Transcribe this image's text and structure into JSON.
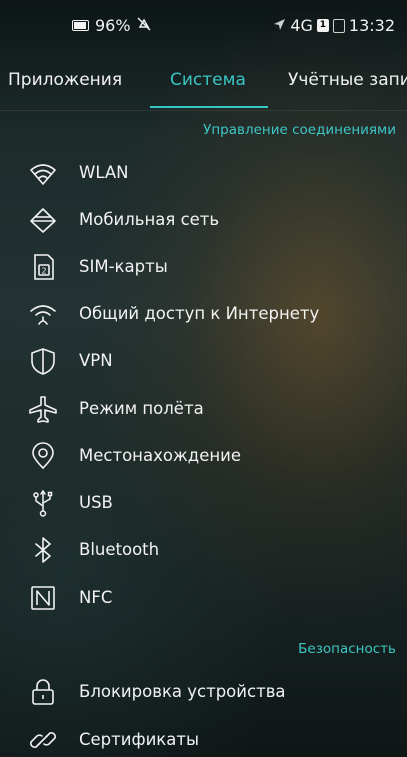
{
  "status_bar": {
    "battery": "96%",
    "network": "4G",
    "sim_badge": "1",
    "time": "13:32"
  },
  "tabs": [
    {
      "label": "Приложения",
      "active": false
    },
    {
      "label": "Система",
      "active": true
    },
    {
      "label": "Учётные запи",
      "active": false
    }
  ],
  "sections": {
    "connections": {
      "title": "Управление соединениями",
      "items": [
        {
          "label": "WLAN",
          "icon": "wifi-icon"
        },
        {
          "label": "Мобильная сеть",
          "icon": "mobile-network-icon"
        },
        {
          "label": "SIM-карты",
          "icon": "sim-card-icon"
        },
        {
          "label": "Общий доступ к Интернету",
          "icon": "hotspot-icon"
        },
        {
          "label": "VPN",
          "icon": "shield-icon"
        },
        {
          "label": "Режим полёта",
          "icon": "airplane-icon"
        },
        {
          "label": "Местонахождение",
          "icon": "location-pin-icon"
        },
        {
          "label": "USB",
          "icon": "usb-icon"
        },
        {
          "label": "Bluetooth",
          "icon": "bluetooth-icon"
        },
        {
          "label": "NFC",
          "icon": "nfc-icon"
        }
      ]
    },
    "security": {
      "title": "Безопасность",
      "items": [
        {
          "label": "Блокировка устройства",
          "icon": "lock-icon"
        },
        {
          "label": "Сертификаты",
          "icon": "certificate-icon"
        }
      ]
    }
  },
  "colors": {
    "accent": "#38c6c4",
    "text": "#f2f2f2"
  }
}
